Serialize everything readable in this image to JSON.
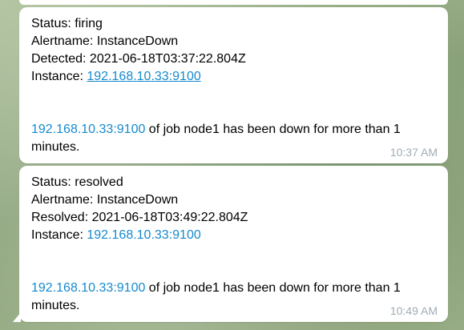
{
  "messages": [
    {
      "status": "Status: firing",
      "alertname": "Alertname: InstanceDown",
      "time_label": "Detected: 2021-06-18T03:37:22.804Z",
      "instance_label": "Instance: ",
      "instance_link": "192.168.10.33:9100",
      "summary_link": "192.168.10.33:9100",
      "summary_text": " of job node1 has been down for more than 1 minutes.",
      "timestamp": "10:37 AM"
    },
    {
      "status": "Status: resolved",
      "alertname": "Alertname: InstanceDown",
      "time_label": "Resolved: 2021-06-18T03:49:22.804Z",
      "instance_label": "Instance: ",
      "instance_link": "192.168.10.33:9100",
      "summary_link": "192.168.10.33:9100",
      "summary_text": " of job node1 has been down for more than 1 minutes.",
      "timestamp": "10:49 AM"
    }
  ],
  "colors": {
    "link": "#168acd",
    "bubble": "#ffffff",
    "timestamp": "#a0acb6"
  }
}
